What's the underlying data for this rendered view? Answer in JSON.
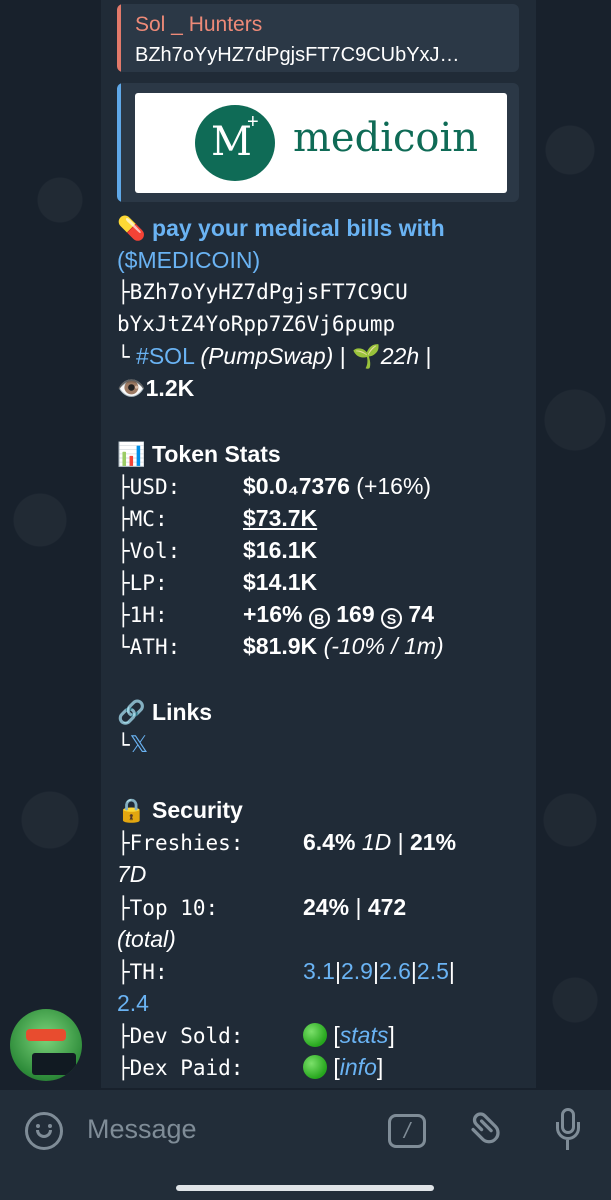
{
  "reply": {
    "sender": "Sol _ Hunters",
    "text": "BZh7oYyHZ7dPgjsFT7C9CUbYxJ…"
  },
  "preview": {
    "logo_text": "medicoin",
    "logo_mark": "M",
    "logo_plus": "+"
  },
  "message": {
    "headline_icon": "💊",
    "headline": "pay your medical bills with",
    "ticker": "($MEDICOIN)",
    "ca_prefix": "├",
    "ca_line1": "BZh7oYyHZ7dPgjsFT7C9CU",
    "ca_line2": "bYxJtZ4YoRpp7Z6Vj6pump",
    "chain_prefix": "└",
    "chain_tag": "#SOL",
    "dex": "(PumpSwap)",
    "sep1": "|",
    "age_icon": "🌱",
    "age": "22h",
    "sep2": "|",
    "views_icon": "👁️",
    "views": "1.2K",
    "stats": {
      "icon": "📊",
      "title": "Token Stats",
      "rows": [
        {
          "prefix": "├",
          "label": "USD:",
          "value": "$0.0₄7376",
          "extra": "(+16%)"
        },
        {
          "prefix": "├",
          "label": "MC:",
          "value": "$73.7K",
          "extra": ""
        },
        {
          "prefix": "├",
          "label": "Vol:",
          "value": "$16.1K",
          "extra": ""
        },
        {
          "prefix": "├",
          "label": "LP:",
          "value": "$14.1K",
          "extra": ""
        },
        {
          "prefix": "├",
          "label": "1H:",
          "value": "+16%",
          "buy_icon": "B",
          "buys": "169",
          "sell_icon": "S",
          "sells": "74"
        },
        {
          "prefix": "└",
          "label": "ATH:",
          "value": "$81.9K",
          "extra": "(-10% / 1m)"
        }
      ]
    },
    "links": {
      "icon": "🔗",
      "title": "Links",
      "prefix": "└",
      "x_label": "𝕏"
    },
    "security": {
      "icon": "🔒",
      "title": "Security",
      "freshies_prefix": "├",
      "freshies_label": "Freshies:",
      "freshies_1d": "6.4%",
      "freshies_1d_unit": "1D",
      "freshies_sep": "|",
      "freshies_7d": "21%",
      "freshies_7d_unit": "7D",
      "top10_prefix": "├",
      "top10_label": "Top 10:",
      "top10_pct": "24%",
      "top10_sep": "|",
      "top10_total": "472",
      "top10_unit": "(total)",
      "th_prefix": "├",
      "th_label": "TH:",
      "th_values": [
        "3.1",
        "2.9",
        "2.6",
        "2.5",
        "2.4"
      ],
      "th_sep": "|",
      "dev_prefix": "├",
      "dev_label": "Dev Sold:",
      "dev_link": "stats",
      "dex_prefix": "├",
      "dex_label": "Dex Paid:",
      "dex_link": "info",
      "open_bracket": "[",
      "close_bracket": "]"
    }
  },
  "composer": {
    "placeholder": "Message",
    "cmd_label": "/"
  }
}
